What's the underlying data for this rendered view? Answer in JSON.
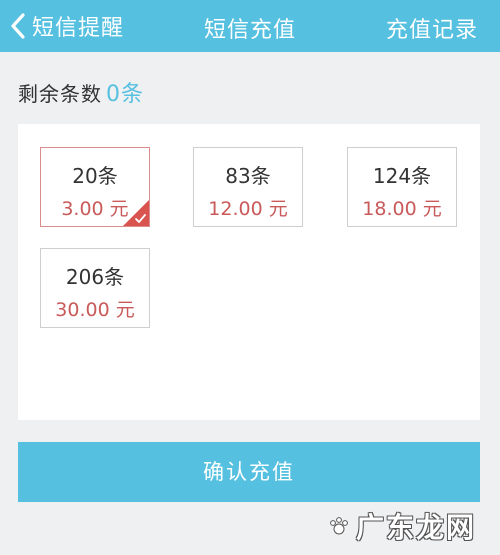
{
  "header": {
    "back_label": "短信提醒",
    "title": "短信充值",
    "records_label": "充值记录"
  },
  "balance": {
    "label": "剩余条数",
    "count": "0条"
  },
  "packages": [
    {
      "amount": "20条",
      "price": "3.00 元",
      "selected": true
    },
    {
      "amount": "83条",
      "price": "12.00 元",
      "selected": false
    },
    {
      "amount": "124条",
      "price": "18.00 元",
      "selected": false
    },
    {
      "amount": "206条",
      "price": "30.00 元",
      "selected": false
    }
  ],
  "confirm_label": "确认充值",
  "watermark": "广东龙网",
  "colors": {
    "brand": "#56c0e0",
    "price": "#c95a5a",
    "selected_check": "#d9534f"
  },
  "icons": {
    "back": "chevron-left-icon",
    "selected": "check-corner-icon"
  }
}
